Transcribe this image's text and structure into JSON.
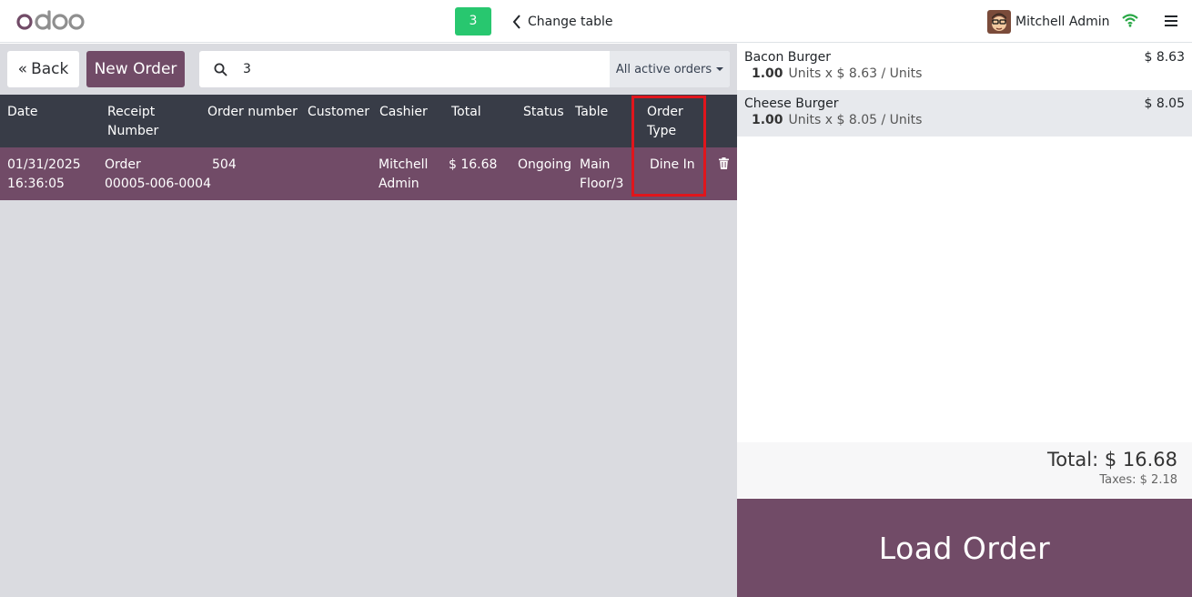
{
  "navbar": {
    "table_number": "3",
    "change_table_label": "Change table",
    "user_name": "Mitchell Admin"
  },
  "controls": {
    "back_label": "Back",
    "new_order_label": "New Order",
    "search_value": "3",
    "filter_label": "All active orders"
  },
  "table": {
    "headers": {
      "date": "Date",
      "receipt_1": "Receipt",
      "receipt_2": "Number",
      "order_number": "Order number",
      "customer": "Customer",
      "cashier": "Cashier",
      "total": "Total",
      "status": "Status",
      "table": "Table",
      "type_1": "Order",
      "type_2": "Type"
    },
    "rows": [
      {
        "date_1": "01/31/2025",
        "date_2": "16:36:05",
        "receipt_1": "Order",
        "receipt_2": "00005-006-0004",
        "order_number": "504",
        "customer": "",
        "cashier_1": "Mitchell",
        "cashier_2": "Admin",
        "total": "$ 16.68",
        "status": "Ongoing",
        "table_1": "Main",
        "table_2": "Floor/3",
        "order_type": "Dine In"
      }
    ]
  },
  "order_lines": [
    {
      "name": "Bacon Burger",
      "price": "$ 8.63",
      "qty": "1.00",
      "detail": "Units x $ 8.63 / Units"
    },
    {
      "name": "Cheese Burger",
      "price": "$ 8.05",
      "qty": "1.00",
      "detail": "Units x $ 8.05 / Units"
    }
  ],
  "summary": {
    "total": "Total: $ 16.68",
    "taxes": "Taxes: $ 2.18"
  },
  "load_order_label": "Load Order",
  "colors": {
    "brand": "#714b67",
    "header_bg": "#383c47",
    "badge": "#28c76f",
    "highlight": "#e0151c"
  }
}
